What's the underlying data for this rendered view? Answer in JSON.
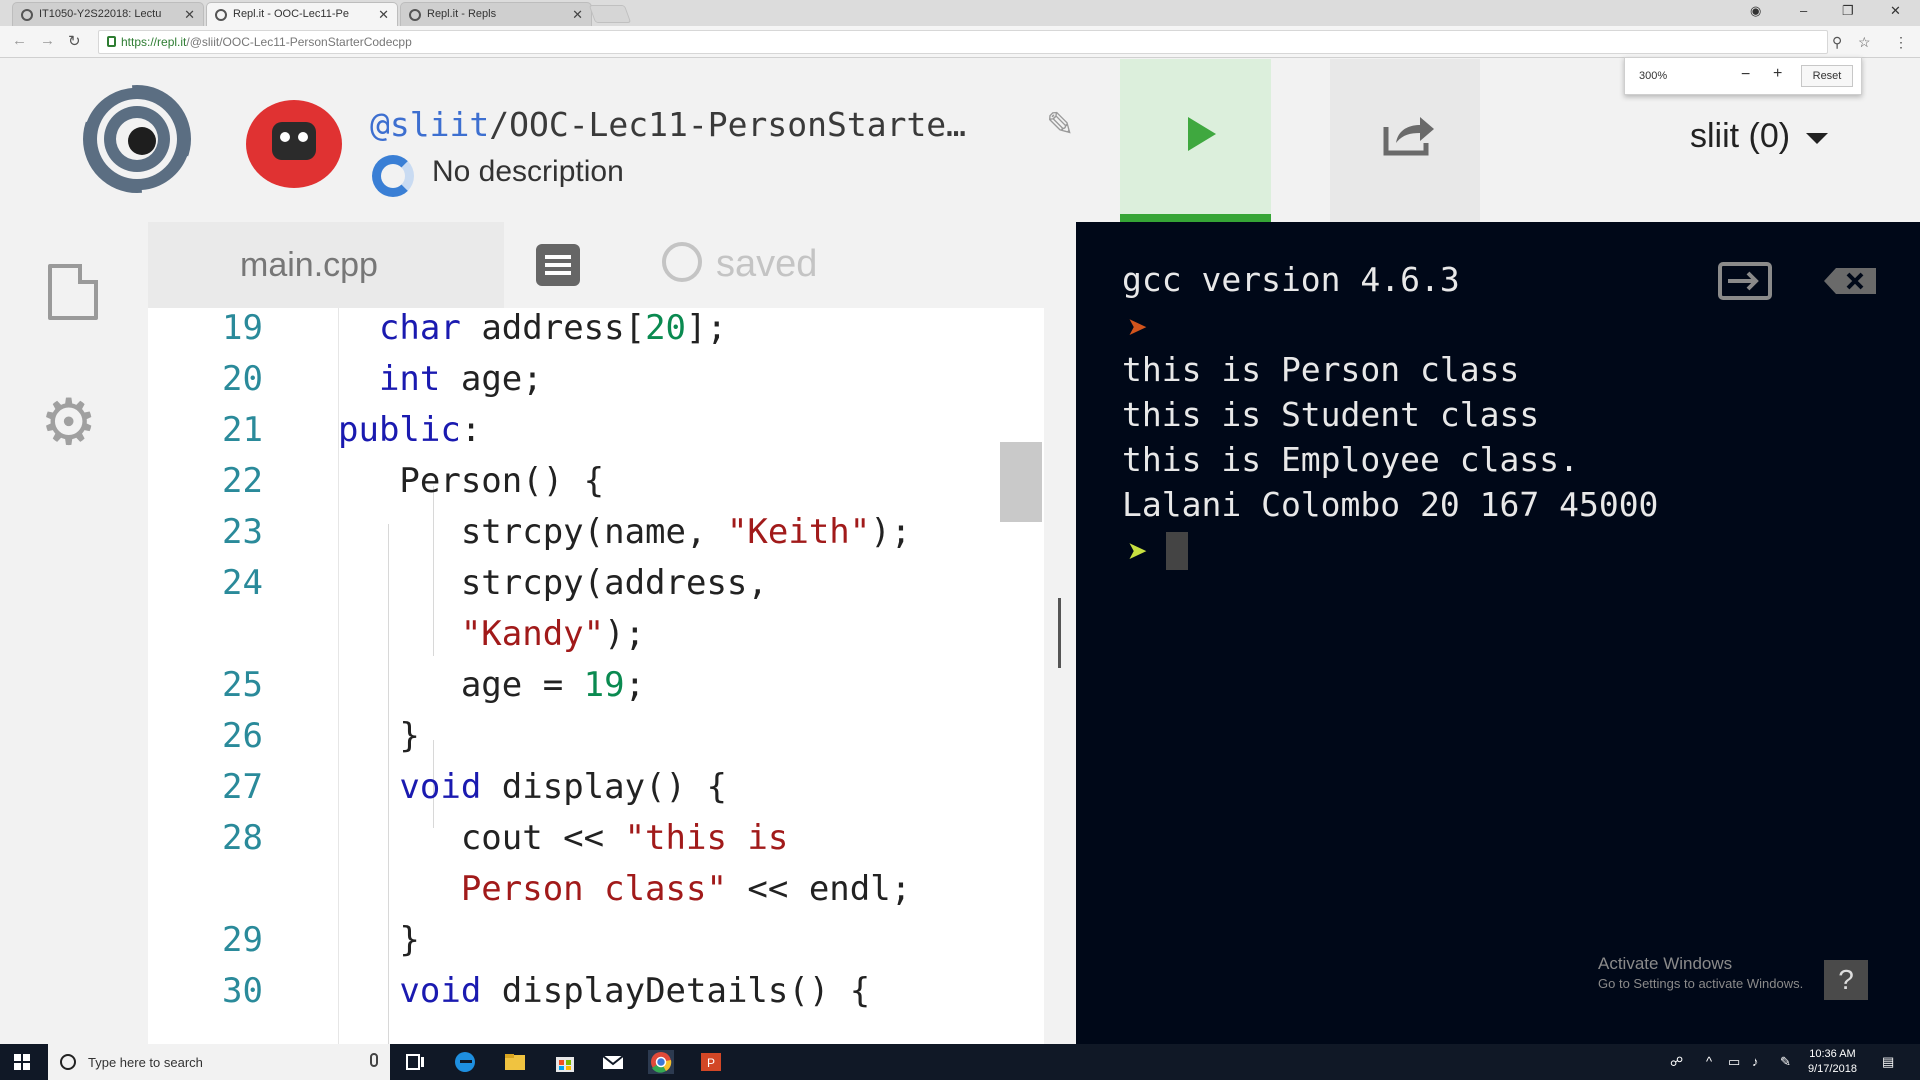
{
  "browser": {
    "tabs": [
      {
        "label": "IT1050-Y2S22018: Lectu"
      },
      {
        "label": "Repl.it - OOC-Lec11-Pe"
      },
      {
        "label": "Repl.it - Repls"
      }
    ],
    "url_host": "https://repl.it",
    "url_path": "/@sliit/OOC-Lec11-PersonStarterCodecpp",
    "zoom": {
      "value": "300%",
      "minus": "−",
      "plus": "+",
      "reset": "Reset"
    }
  },
  "header": {
    "handle": "@sliit",
    "repl_name": "/OOC-Lec11-PersonStarte…",
    "description": "No description",
    "user": "sliit (0)"
  },
  "editor": {
    "file_name": "main.cpp",
    "status": "saved"
  },
  "code_lines": [
    {
      "ln": "19",
      "html": "  <span class=\"kw\">char</span> address[<span class=\"num\">20</span>];"
    },
    {
      "ln": "20",
      "html": "  <span class=\"kw\">int</span> age;"
    },
    {
      "ln": "21",
      "html": "<span class=\"kw\">public</span>:"
    },
    {
      "ln": "22",
      "html": "   Person() {"
    },
    {
      "ln": "23",
      "html": "      strcpy(name, <span class=\"str\">\"Keith\"</span>);"
    },
    {
      "ln": "24",
      "html": "      strcpy(address,"
    },
    {
      "ln": "",
      "html": "      <span class=\"str\">\"Kandy\"</span>);"
    },
    {
      "ln": "25",
      "html": "      age = <span class=\"num\">19</span>;"
    },
    {
      "ln": "26",
      "html": "   }"
    },
    {
      "ln": "27",
      "html": "   <span class=\"kw\">void</span> display() {"
    },
    {
      "ln": "28",
      "html": "      cout << <span class=\"str\">\"this is</span>"
    },
    {
      "ln": "",
      "html": "      <span class=\"str\">Person class\"</span> << endl;"
    },
    {
      "ln": "29",
      "html": "   }"
    },
    {
      "ln": "30",
      "html": "   <span class=\"kw\">void</span> displayDetails() {"
    }
  ],
  "console": {
    "lines": [
      "gcc version 4.6.3",
      "this is Person class",
      "this is Student class",
      "this is Employee class.",
      "Lalani Colombo 20 167 45000"
    ],
    "prompt_colors": [
      "#d2541c",
      "#c8e040"
    ]
  },
  "watermark": {
    "title": "Activate Windows",
    "subtitle": "Go to Settings to activate Windows."
  },
  "taskbar": {
    "search_placeholder": "Type here to search",
    "time": "10:36 AM",
    "date": "9/17/2018"
  }
}
